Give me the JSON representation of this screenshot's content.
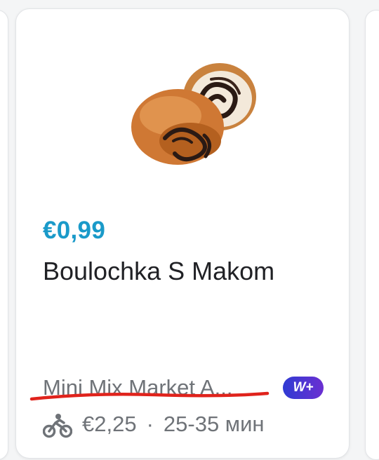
{
  "product": {
    "price": "€0,99",
    "name": "Boulochka S Makom",
    "image_icon": "poppy-seed-roll-image"
  },
  "store": {
    "name": "Mini Mix Market A...",
    "badge": "W+"
  },
  "delivery": {
    "icon": "bicycle-icon",
    "fee": "€2,25",
    "separator": "·",
    "time": "25-35 мин"
  },
  "colors": {
    "price": "#1a9ac9",
    "text": "#202125",
    "muted": "#6f7378",
    "badge_from": "#2f3bd3",
    "badge_to": "#6b2fd1",
    "annotation": "#e0231c"
  }
}
